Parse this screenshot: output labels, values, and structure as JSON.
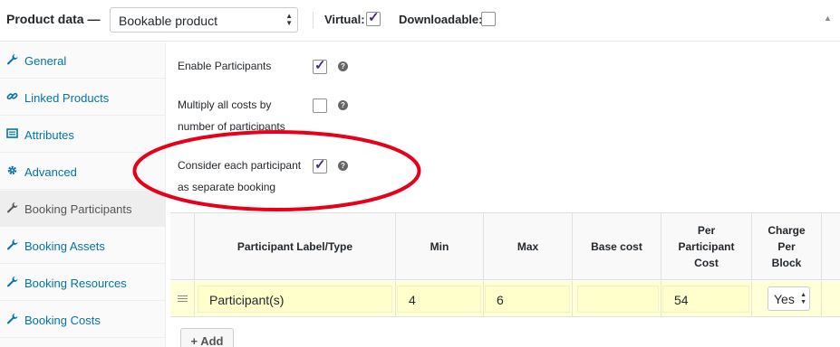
{
  "header": {
    "title": "Product data —",
    "product_type": "Bookable product",
    "virtual_label": "Virtual:",
    "virtual_checked": true,
    "downloadable_label": "Downloadable:",
    "downloadable_checked": false
  },
  "sidebar": {
    "items": [
      {
        "label": "General",
        "icon": "wrench-icon",
        "active": false
      },
      {
        "label": "Linked Products",
        "icon": "link-icon",
        "active": false
      },
      {
        "label": "Attributes",
        "icon": "list-icon",
        "active": false
      },
      {
        "label": "Advanced",
        "icon": "gear-icon",
        "active": false
      },
      {
        "label": "Booking Participants",
        "icon": "wrench-icon",
        "active": true
      },
      {
        "label": "Booking Assets",
        "icon": "wrench-icon",
        "active": false
      },
      {
        "label": "Booking Resources",
        "icon": "wrench-icon",
        "active": false
      },
      {
        "label": "Booking Costs",
        "icon": "wrench-icon",
        "active": false
      }
    ]
  },
  "fields": {
    "enable_participants": {
      "label": "Enable Participants",
      "checked": true
    },
    "multiply_costs": {
      "line1": "Multiply all costs by",
      "line2": "number of participants",
      "checked": false
    },
    "separate_booking": {
      "line1": "Consider each participant",
      "line2": "as separate booking",
      "checked": true
    }
  },
  "table": {
    "headers": {
      "label": "Participant Label/Type",
      "min": "Min",
      "max": "Max",
      "base_cost": "Base cost",
      "per_participant_l1": "Per",
      "per_participant_l2": "Participant",
      "per_participant_l3": "Cost",
      "charge_l1": "Charge",
      "charge_l2": "Per",
      "charge_l3": "Block"
    },
    "rows": [
      {
        "label": "Participant(s)",
        "min": "4",
        "max": "6",
        "base_cost": "",
        "per_participant_cost": "54",
        "charge_per_block": "Yes"
      }
    ]
  },
  "add_button": "+ Add",
  "colors": {
    "link": "#0073aa",
    "annotation": "#e8001a",
    "row_highlight": "#ffffd8",
    "check": "#4a2a7d"
  }
}
